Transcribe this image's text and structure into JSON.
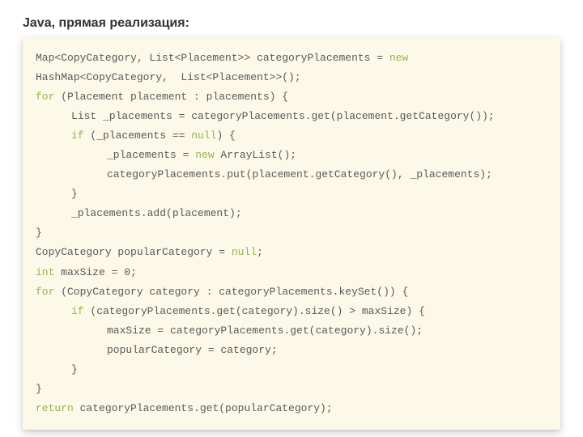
{
  "heading": "Java, прямая реализация:",
  "code": {
    "l1a": "Map<CopyCategory, List<Placement>> categoryPlacements = ",
    "l1b": "new",
    "l2": "HashMap<CopyCategory,  List<Placement>>();",
    "l3a": "for",
    "l3b": " (Placement placement : placements) {",
    "l4": "List _placements = categoryPlacements.get(placement.getCategory());",
    "l5a": "if",
    "l5b": " (_placements == ",
    "l5c": "null",
    "l5d": ") {",
    "l6a": "_placements = ",
    "l6b": "new",
    "l6c": " ArrayList();",
    "l7": "categoryPlacements.put(placement.getCategory(), _placements);",
    "l8": "}",
    "l9": "_placements.add(placement);",
    "l10": "}",
    "l11a": "CopyCategory popularCategory = ",
    "l11b": "null",
    "l11c": ";",
    "l12a": "int",
    "l12b": " maxSize = 0;",
    "l13a": "for",
    "l13b": " (CopyCategory category : categoryPlacements.keySet()) {",
    "l14a": "if",
    "l14b": " (categoryPlacements.get(category).size() > maxSize) {",
    "l15": "maxSize = categoryPlacements.get(category).size();",
    "l16": "popularCategory = category;",
    "l17": "}",
    "l18": "}",
    "l19a": "return",
    "l19b": " categoryPlacements.get(popularCategory);"
  }
}
